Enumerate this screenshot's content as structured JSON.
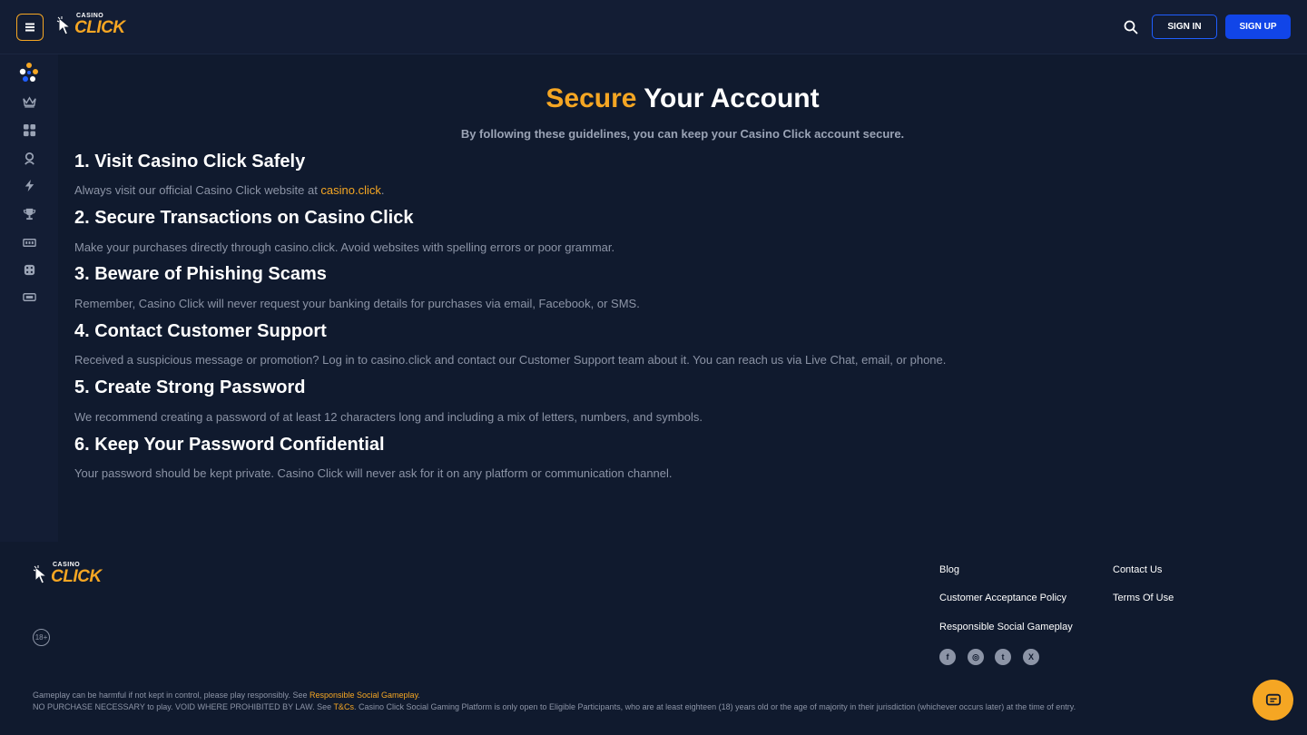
{
  "header": {
    "logo_small": "CASINO",
    "logo_big": "CLICK",
    "sign_in": "SIGN IN",
    "sign_up": "SIGN UP"
  },
  "sidebar": {
    "items": [
      {
        "name": "social-icon"
      },
      {
        "name": "crown-icon"
      },
      {
        "name": "grid-icon"
      },
      {
        "name": "live-dealer-icon"
      },
      {
        "name": "lightning-icon"
      },
      {
        "name": "trophy-icon"
      },
      {
        "name": "slots-icon"
      },
      {
        "name": "dice-icon"
      },
      {
        "name": "ticket-icon"
      }
    ]
  },
  "main": {
    "title_accent": "Secure",
    "title_rest": "Your Account",
    "subtitle": "By following these guidelines, you can keep your Casino Click account secure.",
    "sections": [
      {
        "heading": "1. Visit Casino Click Safely",
        "text": "Always visit our official Casino Click website at ",
        "link": "casino.click",
        "text_after": "."
      },
      {
        "heading": "2. Secure Transactions on Casino Click",
        "text": "Make your purchases directly through casino.click. Avoid websites with spelling errors or poor grammar."
      },
      {
        "heading": "3. Beware of Phishing Scams",
        "text": "Remember, Casino Click will never request your banking details for purchases via email, Facebook, or SMS."
      },
      {
        "heading": "4. Contact Customer Support",
        "text": "Received a suspicious message or promotion? Log in to casino.click and contact our Customer Support team about it. You can reach us via Live Chat, email, or phone."
      },
      {
        "heading": "5. Create Strong Password",
        "text": "We recommend creating a password of at least 12 characters long and including a mix of letters, numbers, and symbols."
      },
      {
        "heading": "6. Keep Your Password Confidential",
        "text": "Your password should be kept private. Casino Click will never ask for it on any platform or communication channel."
      }
    ]
  },
  "footer": {
    "age_badge": "18+",
    "links": {
      "blog": "Blog",
      "customer_acceptance": "Customer Acceptance Policy",
      "responsible": "Responsible Social Gameplay",
      "contact": "Contact Us",
      "terms": "Terms Of Use"
    },
    "social": [
      {
        "name": "facebook-icon",
        "glyph": "f"
      },
      {
        "name": "instagram-icon",
        "glyph": "◎"
      },
      {
        "name": "twitter-icon",
        "glyph": "t"
      },
      {
        "name": "x-icon",
        "glyph": "X"
      }
    ],
    "legal1_pre": "Gameplay can be harmful if not kept in control, please play responsibly. See ",
    "legal1_link": "Responsible Social Gameplay",
    "legal1_post": ".",
    "legal2_pre": "NO PURCHASE NECESSARY to play. VOID WHERE PROHIBITED BY LAW. See ",
    "legal2_link": "T&Cs",
    "legal2_post": ". Casino Click Social Gaming Platform is only open to Eligible Participants, who are at least eighteen (18) years old or the age of majority in their jurisdiction (whichever occurs later) at the time of entry."
  },
  "colors": {
    "accent": "#f5a623",
    "primary": "#1145e8",
    "background": "#101a2e"
  }
}
